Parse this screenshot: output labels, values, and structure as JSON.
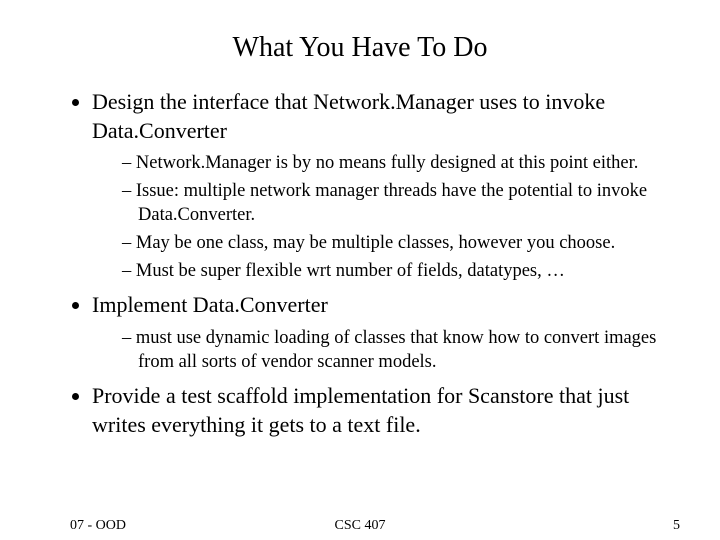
{
  "title": "What You Have To Do",
  "bullets": {
    "b0": "Design the interface that Network.Manager uses to invoke Data.Converter",
    "b0s0": "Network.Manager is by no means fully designed at this point either.",
    "b0s1": "Issue: multiple network manager threads have the potential to invoke Data.Converter.",
    "b0s2": "May be one class, may be multiple classes, however you choose.",
    "b0s3": "Must be super flexible wrt number of fields, datatypes, …",
    "b1": "Implement Data.Converter",
    "b1s0": "must use dynamic loading of classes that know how to convert images from all sorts of vendor scanner models.",
    "b2": "Provide a test scaffold implementation for Scanstore that just writes everything it gets to a text file."
  },
  "footer": {
    "left": "07 - OOD",
    "center": "CSC 407",
    "right": "5"
  }
}
